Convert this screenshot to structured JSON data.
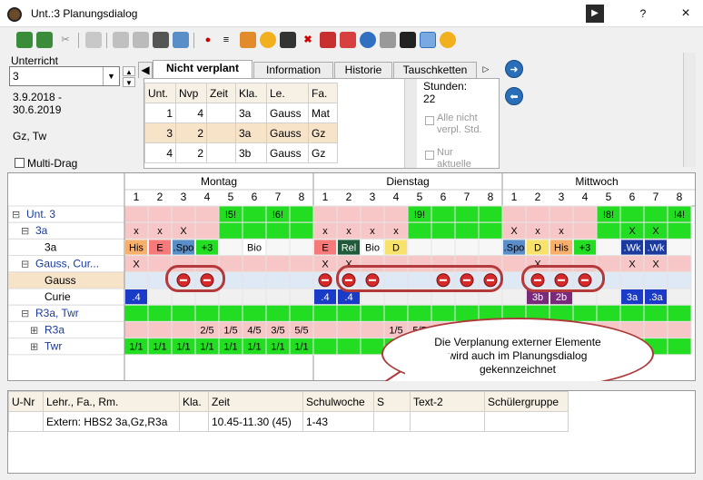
{
  "window": {
    "title": "Unt.:3 Planungsdialog",
    "help_button": "?",
    "close_button": "×",
    "pin_button": "▶"
  },
  "toolbar": {
    "tools": [
      "add-lesson",
      "add-teacher",
      "cut",
      "export",
      "print",
      "lock",
      "binoculars",
      "import",
      "pin",
      "list",
      "palette",
      "clock",
      "teacher-cap",
      "delete-x",
      "delete-lines",
      "stats",
      "help",
      "calculator",
      "grad-cap",
      "pencil",
      "settings"
    ]
  },
  "upper": {
    "unterricht_label": "Unterricht",
    "unterricht_value": "3",
    "date_range_line1": "3.9.2018 -",
    "date_range_line2": "30.6.2019",
    "teachers": "Gz, Tw",
    "multidrag_label": "Multi-Drag",
    "tabs": [
      "Nicht verplant",
      "Information",
      "Historie",
      "Tauschketten"
    ],
    "stunden_label": "Stunden:",
    "stunden_value": "22",
    "alle_nicht_verpl": "Alle nicht verpl. Std.",
    "nur_aktuelle": "Nur aktuelle"
  },
  "list": {
    "headers": [
      "Unt.",
      "Nvp",
      "Zeit",
      "Kla.",
      "Le.",
      "Fa."
    ],
    "rows": [
      [
        "1",
        "4",
        "",
        "3a",
        "Gauss",
        "Mat"
      ],
      [
        "3",
        "2",
        "",
        "3a",
        "Gauss",
        "Gz"
      ],
      [
        "4",
        "2",
        "",
        "3b",
        "Gauss",
        "Gz"
      ]
    ]
  },
  "grid": {
    "days": [
      "Montag",
      "Dienstag",
      "Mittwoch"
    ],
    "periods": [
      "1",
      "2",
      "3",
      "4",
      "5",
      "6",
      "7",
      "8"
    ],
    "rows": [
      {
        "label": "Unt. 3",
        "prefix": "⊟"
      },
      {
        "label": "3a",
        "prefix": "⊟"
      },
      {
        "label": "3a",
        "prefix": ""
      },
      {
        "label": "Gauss, Cur...",
        "prefix": "⊟"
      },
      {
        "label": "Gauss",
        "prefix": ""
      },
      {
        "label": "Curie",
        "prefix": ""
      },
      {
        "label": "R3a, Twr",
        "prefix": "⊟"
      },
      {
        "label": "R3a",
        "prefix": "⊞"
      },
      {
        "label": "Twr",
        "prefix": "⊞"
      }
    ],
    "unt3_marks": {
      "mo": [
        "",
        "",
        "",
        "",
        "!5!",
        "",
        "!6!",
        ""
      ],
      "di": [
        "",
        "",
        "",
        "",
        "!9!",
        "",
        "",
        ""
      ],
      "mi": [
        "",
        "",
        "",
        "",
        "!8!",
        "",
        "",
        "!4!"
      ]
    },
    "class3a_marks": {
      "mo": [
        "x",
        "x",
        "X",
        "",
        "",
        "",
        "",
        ""
      ],
      "di": [
        "x",
        "x",
        "x",
        "x",
        "",
        "",
        "",
        ""
      ],
      "mi": [
        "X",
        "x",
        "x",
        "",
        "",
        "X",
        "X",
        ""
      ]
    },
    "class3a_subjects": {
      "mo": [
        "His",
        "E",
        ".Spo",
        "+3",
        "",
        "Bio",
        "",
        ""
      ],
      "di": [
        "E",
        "Rel",
        "Bio",
        "D",
        "",
        "",
        "",
        ""
      ],
      "mi": [
        ".Spo",
        "D",
        "His",
        "+3",
        "",
        ".Wk",
        ".Wk",
        ""
      ]
    },
    "gauss_marks": {
      "mo": [
        "X",
        "",
        "",
        "",
        "",
        "",
        "",
        ""
      ],
      "di": [
        "X",
        "X",
        "",
        "",
        "",
        "",
        "",
        ""
      ],
      "mi": [
        "",
        "X",
        "",
        "",
        "",
        "X",
        "X",
        ""
      ]
    },
    "curie_marks": {
      "mo": [
        ".4",
        "",
        "",
        "",
        "",
        "",
        "",
        ""
      ],
      "di": [
        ".4",
        ".4",
        "",
        "",
        "",
        "",
        "",
        ""
      ],
      "mi": [
        "",
        "3b",
        "2b",
        "",
        "",
        "3a",
        ".3a",
        ""
      ]
    },
    "r3a_marks": {
      "mo": [
        "",
        "",
        "",
        "2/5",
        "1/5",
        "4/5",
        "3/5",
        "5/5"
      ],
      "di": [
        "",
        "",
        "",
        "1/5",
        "5/5",
        "",
        "",
        ""
      ],
      "mi": [
        "",
        "",
        "",
        "",
        "",
        "",
        "",
        ""
      ]
    },
    "twr_marks": {
      "mo": [
        "1/1",
        "1/1",
        "1/1",
        "1/1",
        "1/1",
        "1/1",
        "1/1",
        "1/1"
      ],
      "di": [
        "",
        "",
        "",
        "1/1",
        "1/1",
        "",
        "",
        ""
      ],
      "mi": [
        "",
        "",
        "",
        "",
        "",
        "",
        "",
        ""
      ]
    }
  },
  "callout": {
    "text_line1": "Die Verplanung externer Elemente",
    "text_line2": "wird auch im Planungsdialog",
    "text_line3": "gekennzeichnet"
  },
  "details": {
    "headers": [
      "U-Nr",
      "Lehr., Fa., Rm.",
      "Kla.",
      "Zeit",
      "Schulwoche",
      "S",
      "Text-2",
      "Schülergruppe"
    ],
    "row": [
      "",
      "Extern: HBS2 3a,Gz,R3a",
      "",
      "10.45-11.30 (45)",
      "1-43",
      "",
      "",
      ""
    ]
  },
  "colors": {
    "accent": "#2a6db8",
    "highlight": "#b33a3a",
    "green": "#22dd22",
    "pink": "#f7c6c6"
  }
}
